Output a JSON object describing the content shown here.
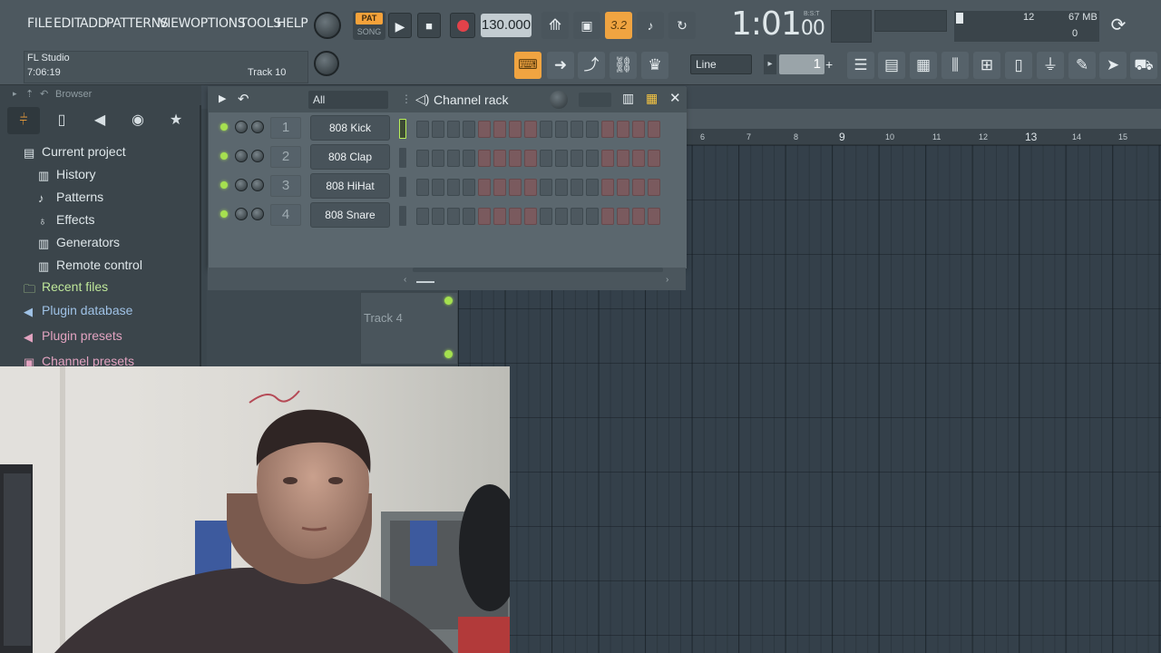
{
  "menu": [
    "FILE",
    "EDIT",
    "ADD",
    "PATTERNS",
    "VIEW",
    "OPTIONS",
    "TOOLS",
    "HELP"
  ],
  "hint": {
    "app": "FL Studio",
    "elapsed": "7:06:19",
    "track": "Track 10"
  },
  "transport": {
    "pat_label": "PAT",
    "song_label": "SONG",
    "tempo": "130.000",
    "time_main": "1:01",
    "time_sub": "00",
    "time_units": "B:S:T",
    "snap_label": "3.2"
  },
  "cpu": {
    "value1": "12",
    "mem": "67 MB",
    "value2": "0"
  },
  "toolbar2": {
    "snap_mode": "Line",
    "step_value": "1"
  },
  "browser": {
    "title": "Browser",
    "items": [
      {
        "label": "Current project",
        "icon": "folder-icon",
        "color": "#dfe7ea"
      },
      {
        "label": "History",
        "icon": "history-icon",
        "color": "#dfe7ea"
      },
      {
        "label": "Patterns",
        "icon": "note-icon",
        "color": "#dfe7ea"
      },
      {
        "label": "Effects",
        "icon": "effects-icon",
        "color": "#dfe7ea"
      },
      {
        "label": "Generators",
        "icon": "generators-icon",
        "color": "#dfe7ea"
      },
      {
        "label": "Remote control",
        "icon": "remote-icon",
        "color": "#dfe7ea"
      },
      {
        "label": "Recent files",
        "icon": "recent-folder-icon",
        "color": "#bfe79a"
      },
      {
        "label": "Plugin database",
        "icon": "speaker-icon",
        "color": "#9fc2e6"
      },
      {
        "label": "Plugin presets",
        "icon": "speaker-icon",
        "color": "#e2a3c0"
      },
      {
        "label": "Channel presets",
        "icon": "channel-icon",
        "color": "#e2a3c0"
      }
    ]
  },
  "channel_rack": {
    "title": "Channel rack",
    "filter": "All",
    "add_label": "+",
    "channels": [
      {
        "num": "1",
        "name": "808 Kick",
        "selected": true
      },
      {
        "num": "2",
        "name": "808 Clap",
        "selected": false
      },
      {
        "num": "3",
        "name": "808 HiHat",
        "selected": false
      },
      {
        "num": "4",
        "name": "808 Snare",
        "selected": false
      }
    ]
  },
  "playlist": {
    "ruler": [
      "6",
      "7",
      "8",
      "9",
      "10",
      "11",
      "12",
      "13",
      "14",
      "15"
    ],
    "track_label": "Track 4"
  },
  "colors": {
    "accent": "#f5a23a",
    "led": "#a6e050",
    "step_red": "#7a5a5e",
    "step_grey": "#4d585f"
  }
}
